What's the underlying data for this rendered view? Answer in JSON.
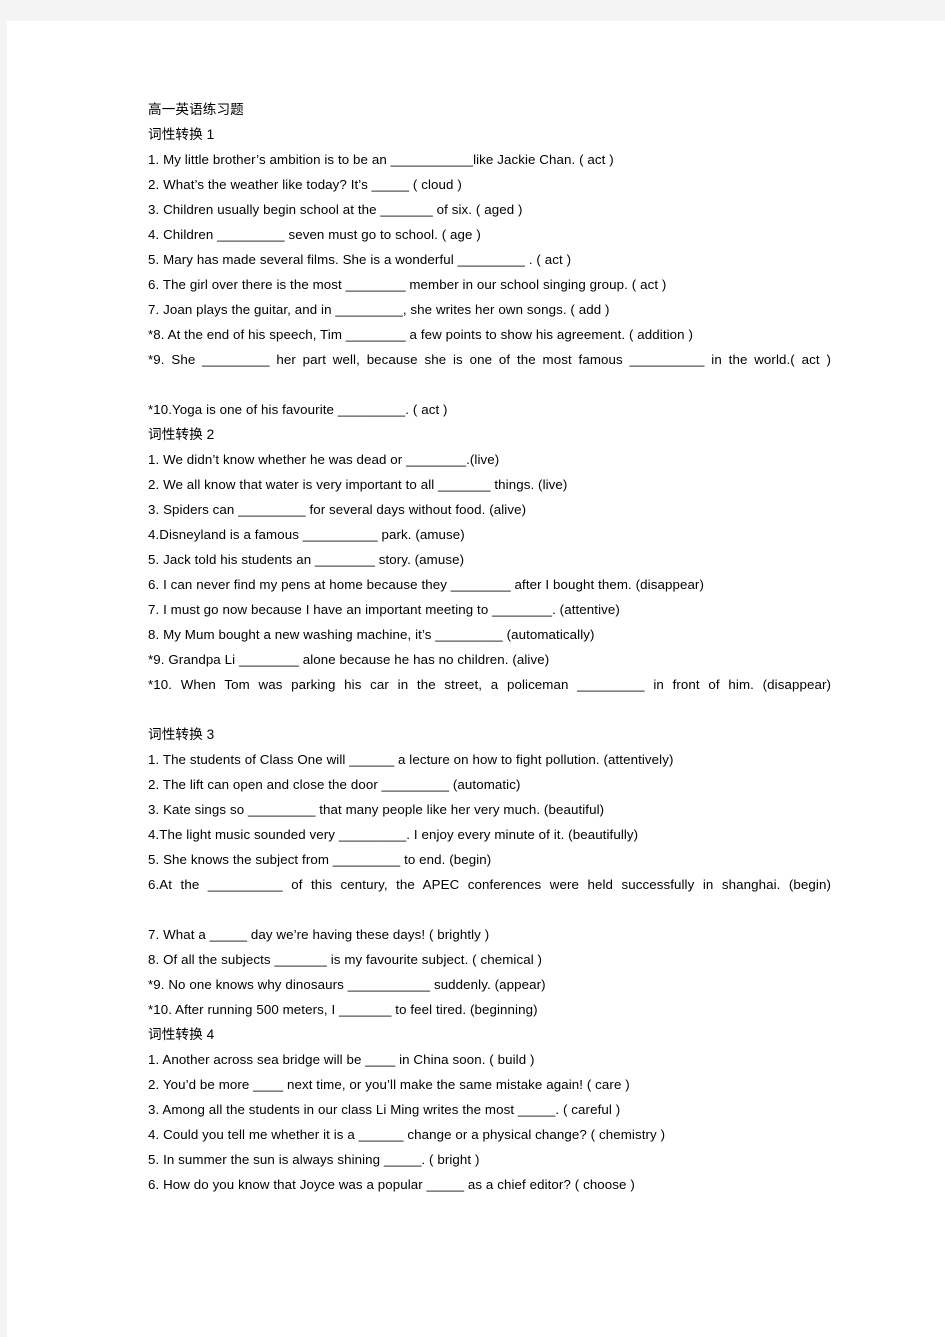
{
  "document": {
    "title": "高一英语练习题",
    "sections": [
      {
        "heading": "词性转换 1",
        "items": [
          "1. My little brother’s ambition is to be an ___________like Jackie Chan. ( act )",
          "2. What’s the weather like today? It’s _____ ( cloud )",
          "3. Children usually begin school at the _______ of six. ( aged )",
          "4. Children _________ seven must go to school. ( age )",
          "5. Mary has made several films. She is a wonderful _________ . ( act )",
          "6. The girl over there is the most ________ member in our school singing group. ( act )",
          "7. Joan plays the guitar, and in _________, she writes her own songs. ( add )",
          "*8. At the end of his speech, Tim ________ a few points to show his agreement. ( addition )",
          "*9. She _________ her part well, because she is one of the most famous __________ in the world.( act )",
          "*10.Yoga is one of his favourite _________. ( act )"
        ]
      },
      {
        "heading": "词性转换 2",
        "items": [
          "1. We didn’t know whether he was dead or ________.(live)",
          "2. We all know that water is very important to all _______ things. (live)",
          "3. Spiders can _________ for several days without food. (alive)",
          "4.Disneyland is a famous __________ park. (amuse)",
          "5. Jack told his students an ________ story. (amuse)",
          "6. I can never find my pens at home because they ________ after I bought them. (disappear)",
          "7. I must go now because I have an important meeting to ________. (attentive)",
          "8. My Mum bought a new washing machine, it’s _________ (automatically)",
          "*9. Grandpa Li ________ alone because he has no children. (alive)",
          "*10. When Tom was parking his car in the street, a policeman _________ in front of him. (disappear)"
        ]
      },
      {
        "heading": "词性转换 3",
        "items": [
          "1. The students of Class One will ______ a lecture on how to fight pollution. (attentively)",
          "2. The lift can open and close the door _________ (automatic)",
          "3. Kate sings so _________ that many people like her very much. (beautiful)",
          "4.The light music sounded very _________. I enjoy every minute of it. (beautifully)",
          "5. She knows the subject from _________ to end. (begin)",
          "6.At the __________ of this century, the APEC conferences were held successfully in shanghai. (begin)",
          "7. What a _____ day we’re having these days! ( brightly )",
          "8. Of all the subjects _______ is my favourite subject. ( chemical )",
          "*9. No one knows why dinosaurs ___________ suddenly. (appear)",
          "*10. After running 500 meters, I _______ to feel tired. (beginning)"
        ]
      },
      {
        "heading": "词性转换 4",
        "items": [
          "1. Another across sea bridge will be ____ in China soon. ( build )",
          "2. You’d be more ____ next time, or you’ll make the same mistake again! ( care )",
          "3. Among all the students in our class Li Ming writes the most _____. ( careful )",
          "4. Could you tell me whether it is a ______ change or a physical change? ( chemistry )",
          "5. In summer the sun is always shining _____. ( bright )",
          "6. How do you know that Joyce was a popular _____ as a chief editor? ( choose )"
        ]
      }
    ]
  },
  "colors": {
    "page_background": "#ffffff",
    "chrome_background": "#f4f4f4",
    "text": "#000000"
  }
}
